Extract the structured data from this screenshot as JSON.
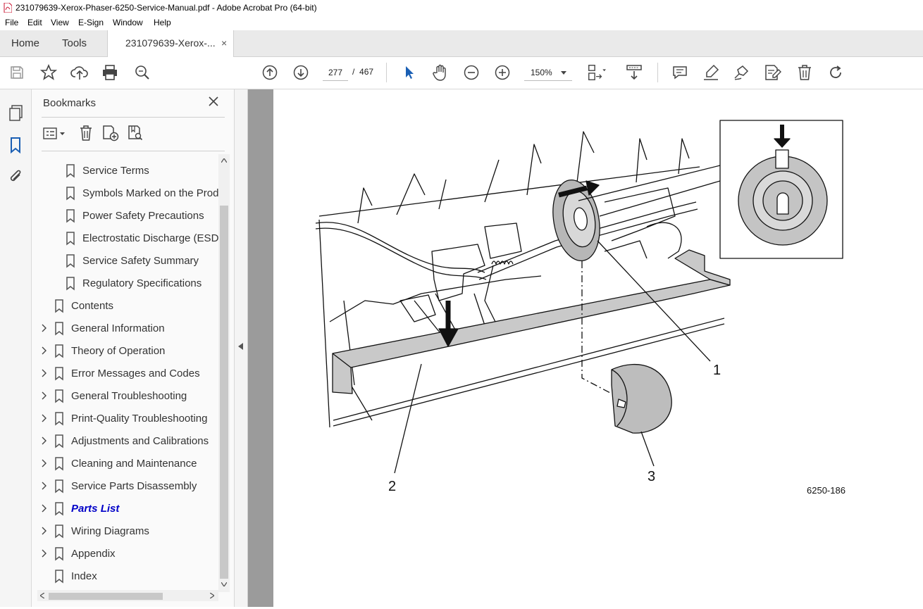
{
  "window": {
    "title": "231079639-Xerox-Phaser-6250-Service-Manual.pdf - Adobe Acrobat Pro (64-bit)"
  },
  "menu": [
    "File",
    "Edit",
    "View",
    "E-Sign",
    "Window",
    "Help"
  ],
  "tabs": {
    "home": "Home",
    "tools": "Tools",
    "document": "231079639-Xerox-...",
    "close": "×"
  },
  "toolbar": {
    "page_current": "277",
    "page_separator": "/",
    "page_total": "467",
    "zoom": "150%"
  },
  "bookmarks": {
    "title": "Bookmarks",
    "items": [
      {
        "label": "Service Terms",
        "level": 2,
        "expandable": false,
        "bold": false
      },
      {
        "label": "Symbols Marked on the Prod",
        "level": 2,
        "expandable": false,
        "bold": false
      },
      {
        "label": "Power Safety Precautions",
        "level": 2,
        "expandable": false,
        "bold": false
      },
      {
        "label": "Electrostatic Discharge (ESD)",
        "level": 2,
        "expandable": false,
        "bold": false
      },
      {
        "label": "Service Safety Summary",
        "level": 2,
        "expandable": false,
        "bold": false
      },
      {
        "label": "Regulatory Specifications",
        "level": 2,
        "expandable": false,
        "bold": false
      },
      {
        "label": "Contents",
        "level": 1,
        "expandable": false,
        "bold": false
      },
      {
        "label": "General Information",
        "level": 1,
        "expandable": true,
        "bold": false
      },
      {
        "label": "Theory of Operation",
        "level": 1,
        "expandable": true,
        "bold": false
      },
      {
        "label": "Error Messages and Codes",
        "level": 1,
        "expandable": true,
        "bold": false
      },
      {
        "label": "General Troubleshooting",
        "level": 1,
        "expandable": true,
        "bold": false
      },
      {
        "label": "Print-Quality Troubleshooting",
        "level": 1,
        "expandable": true,
        "bold": false
      },
      {
        "label": "Adjustments and Calibrations",
        "level": 1,
        "expandable": true,
        "bold": false
      },
      {
        "label": "Cleaning and Maintenance",
        "level": 1,
        "expandable": true,
        "bold": false
      },
      {
        "label": "Service Parts Disassembly",
        "level": 1,
        "expandable": true,
        "bold": false
      },
      {
        "label": "Parts List",
        "level": 1,
        "expandable": true,
        "bold": true
      },
      {
        "label": "Wiring Diagrams",
        "level": 1,
        "expandable": true,
        "bold": false
      },
      {
        "label": "Appendix",
        "level": 1,
        "expandable": true,
        "bold": false
      },
      {
        "label": "Index",
        "level": 1,
        "expandable": false,
        "bold": false
      }
    ]
  },
  "figure": {
    "callout_1": "1",
    "callout_2": "2",
    "callout_3": "3",
    "figure_id": "6250-186"
  },
  "colors": {
    "accent_blue": "#1a5fb4",
    "selected_bookmark": "#0000c8"
  }
}
